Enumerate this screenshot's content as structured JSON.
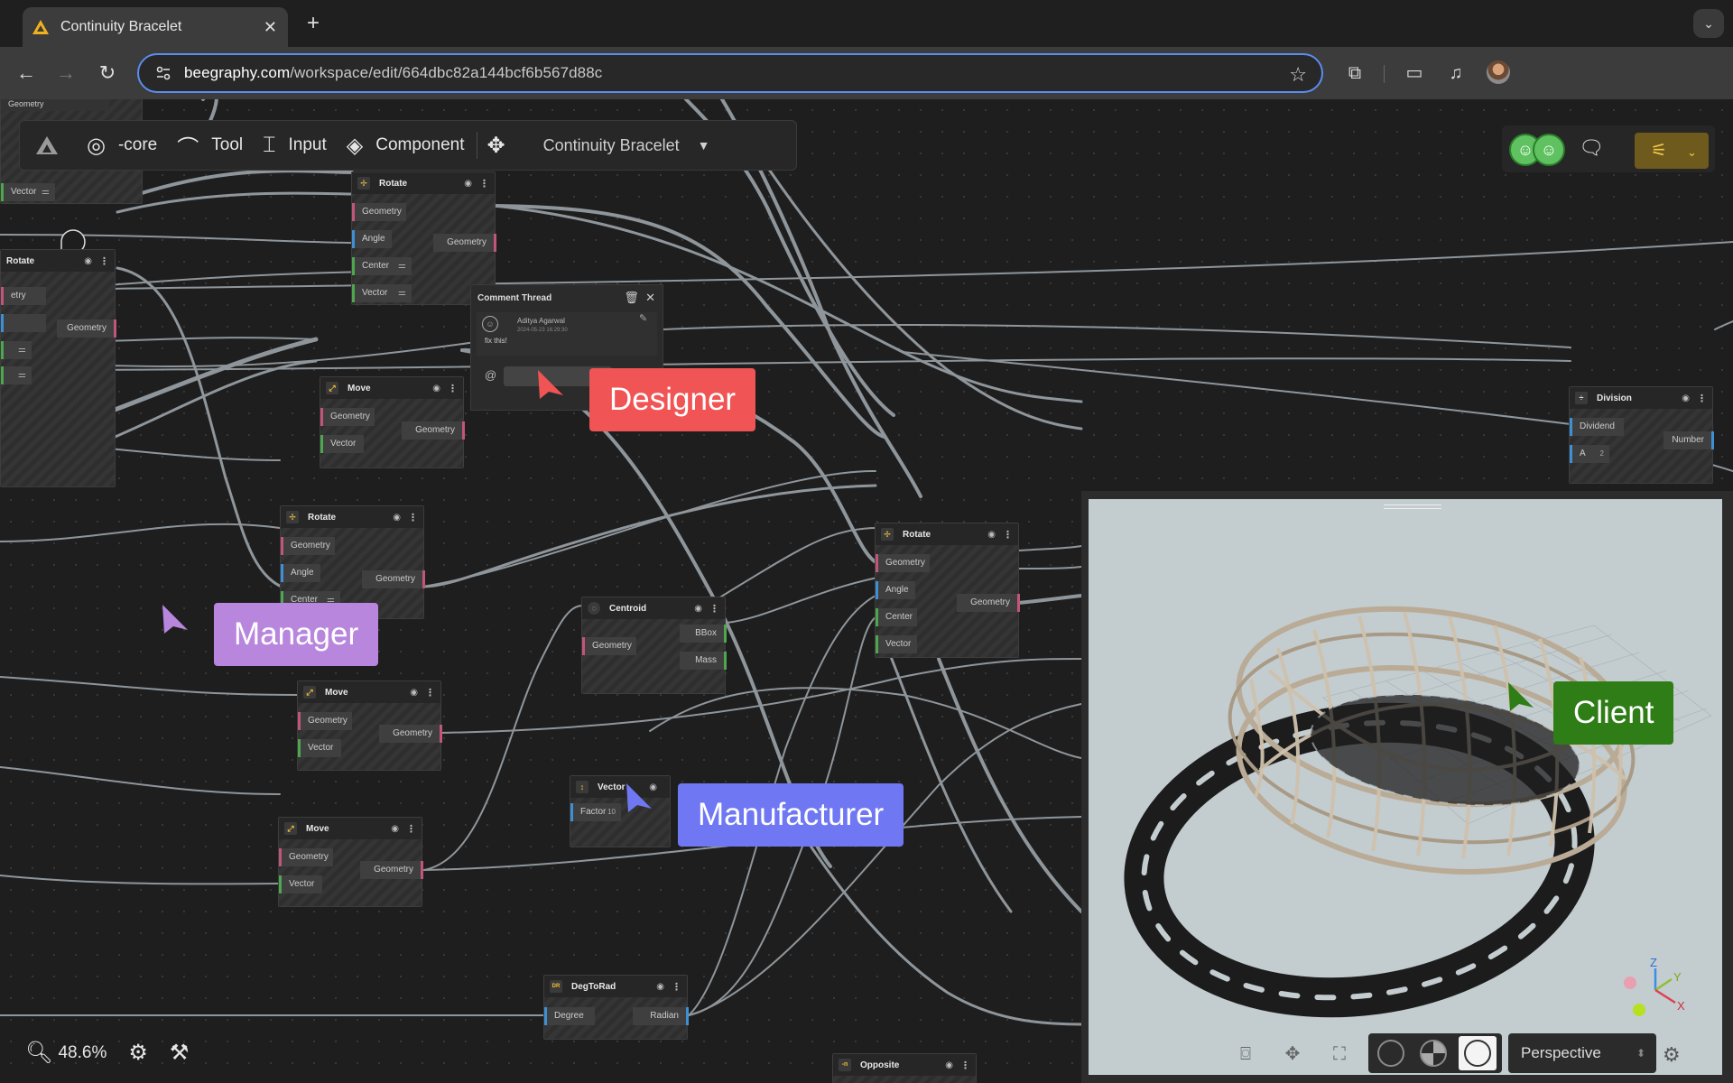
{
  "browser": {
    "tab_title": "Continuity Bracelet",
    "url_host": "beegraphy.com",
    "url_path": "/workspace/edit/664dbc82a144bcf6b567d88c"
  },
  "app_toolbar": {
    "core_label": "-core",
    "tool_label": "Tool",
    "input_label": "Input",
    "component_label": "Component",
    "project_name": "Continuity Bracelet"
  },
  "nodes": {
    "partial_top_left": {
      "port1": "Geometry",
      "port2": "Vector"
    },
    "rotate_left": {
      "title": "Rotate",
      "in1": "etry",
      "out": "Geometry"
    },
    "rotate_top": {
      "title": "Rotate",
      "in1": "Geometry",
      "in2": "Angle",
      "in3": "Center",
      "in4": "Vector",
      "out": "Geometry"
    },
    "move_1": {
      "title": "Move",
      "in1": "Geometry",
      "in2": "Vector",
      "out": "Geometry"
    },
    "rotate_mid": {
      "title": "Rotate",
      "in1": "Geometry",
      "in2": "Angle",
      "in3": "Center",
      "out": "Geometry"
    },
    "move_2": {
      "title": "Move",
      "in1": "Geometry",
      "in2": "Vector",
      "out": "Geometry"
    },
    "move_3": {
      "title": "Move",
      "in1": "Geometry",
      "in2": "Vector",
      "out": "Geometry"
    },
    "centroid": {
      "title": "Centroid",
      "in1": "Geometry",
      "out1": "BBox",
      "out2": "Mass"
    },
    "rotate_right": {
      "title": "Rotate",
      "in1": "Geometry",
      "in2": "Angle",
      "in3": "Center",
      "in4": "Vector",
      "out": "Geometry"
    },
    "vector": {
      "title": "Vector",
      "in1": "Factor",
      "in1_value": "10"
    },
    "degtorad": {
      "title": "DegToRad",
      "in1": "Degree",
      "out": "Radian"
    },
    "opposite": {
      "title": "Opposite"
    },
    "division": {
      "title": "Division",
      "in1": "Dividend",
      "in2": "A",
      "in2_value": "2",
      "out": "Number"
    }
  },
  "comment_thread": {
    "title": "Comment Thread",
    "author": "Aditya Agarwal",
    "date": "2024-05-23 16:29:30",
    "text": "fix this!"
  },
  "cursors": [
    {
      "label": "Designer",
      "color": "#f05454"
    },
    {
      "label": "Manager",
      "color": "#b886dc"
    },
    {
      "label": "Manufacturer",
      "color": "#6f78f2"
    },
    {
      "label": "Client",
      "color": "#2f7d16"
    }
  ],
  "viewport": {
    "camera_mode": "Perspective",
    "axis_x": "X",
    "axis_y": "Y",
    "axis_z": "Z"
  },
  "status": {
    "zoom": "48.6%"
  }
}
